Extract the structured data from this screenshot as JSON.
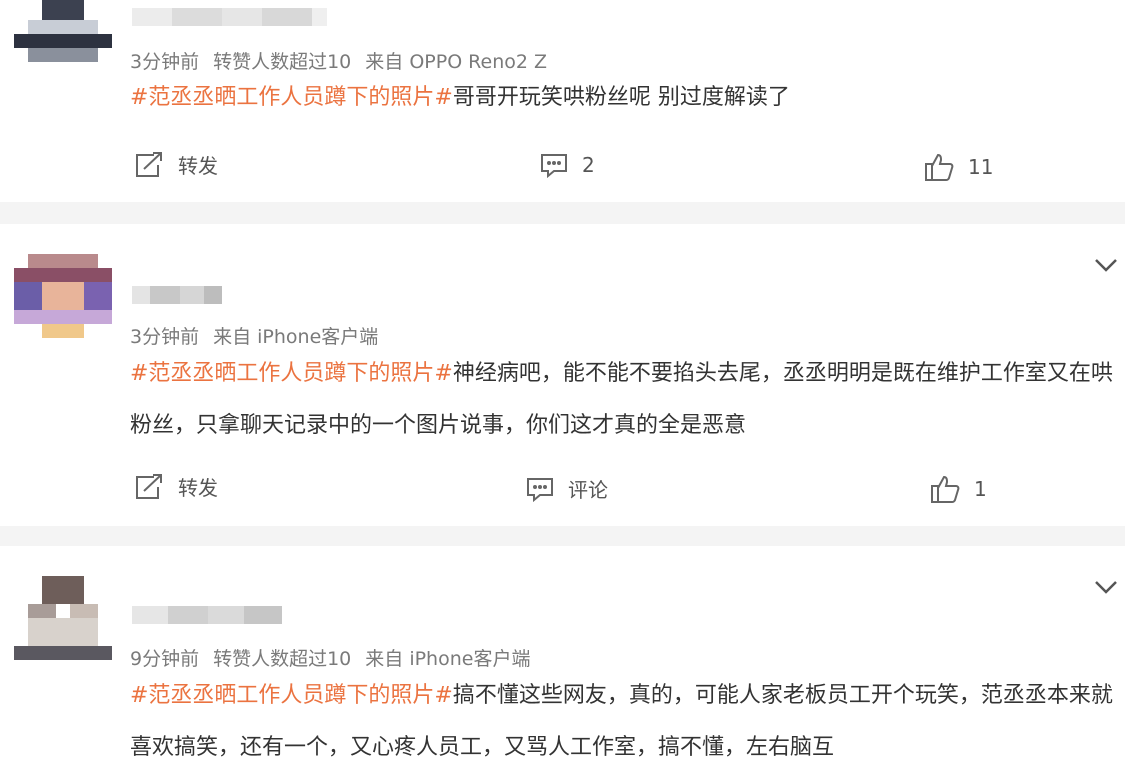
{
  "posts": [
    {
      "meta_time": "3分钟前",
      "meta_likes_note": "转赞人数超过10",
      "meta_source": "来自 OPPO Reno2 Z",
      "hashtag": "#范丞丞晒工作人员蹲下的照片#",
      "text": "哥哥开玩笑哄粉丝呢 别过度解读了",
      "repost_label": "转发",
      "comment_label": "2",
      "like_count": "11"
    },
    {
      "meta_time": "3分钟前",
      "meta_source": "来自 iPhone客户端",
      "hashtag": "#范丞丞晒工作人员蹲下的照片#",
      "text": "神经病吧，能不能不要掐头去尾，丞丞明明是既在维护工作室又在哄粉丝，只拿聊天记录中的一个图片说事，你们这才真的全是恶意",
      "repost_label": "转发",
      "comment_label": "评论",
      "like_count": "1"
    },
    {
      "meta_time": "9分钟前",
      "meta_likes_note": "转赞人数超过10",
      "meta_source": "来自 iPhone客户端",
      "hashtag": "#范丞丞晒工作人员蹲下的照片#",
      "text": "搞不懂这些网友，真的，可能人家老板员工开个玩笑，范丞丞本来就喜欢搞笑，还有一个，又心疼人员工，又骂人工作室，搞不懂，左右脑互"
    }
  ],
  "icons": {
    "repost": "share-icon",
    "comment": "comment-icon",
    "like": "thumbs-up-icon",
    "expand": "chevron-down-icon"
  },
  "colors": {
    "hashtag": "#eb7340",
    "meta": "#7a7a7a",
    "text": "#333333",
    "separator": "#f4f4f4"
  }
}
